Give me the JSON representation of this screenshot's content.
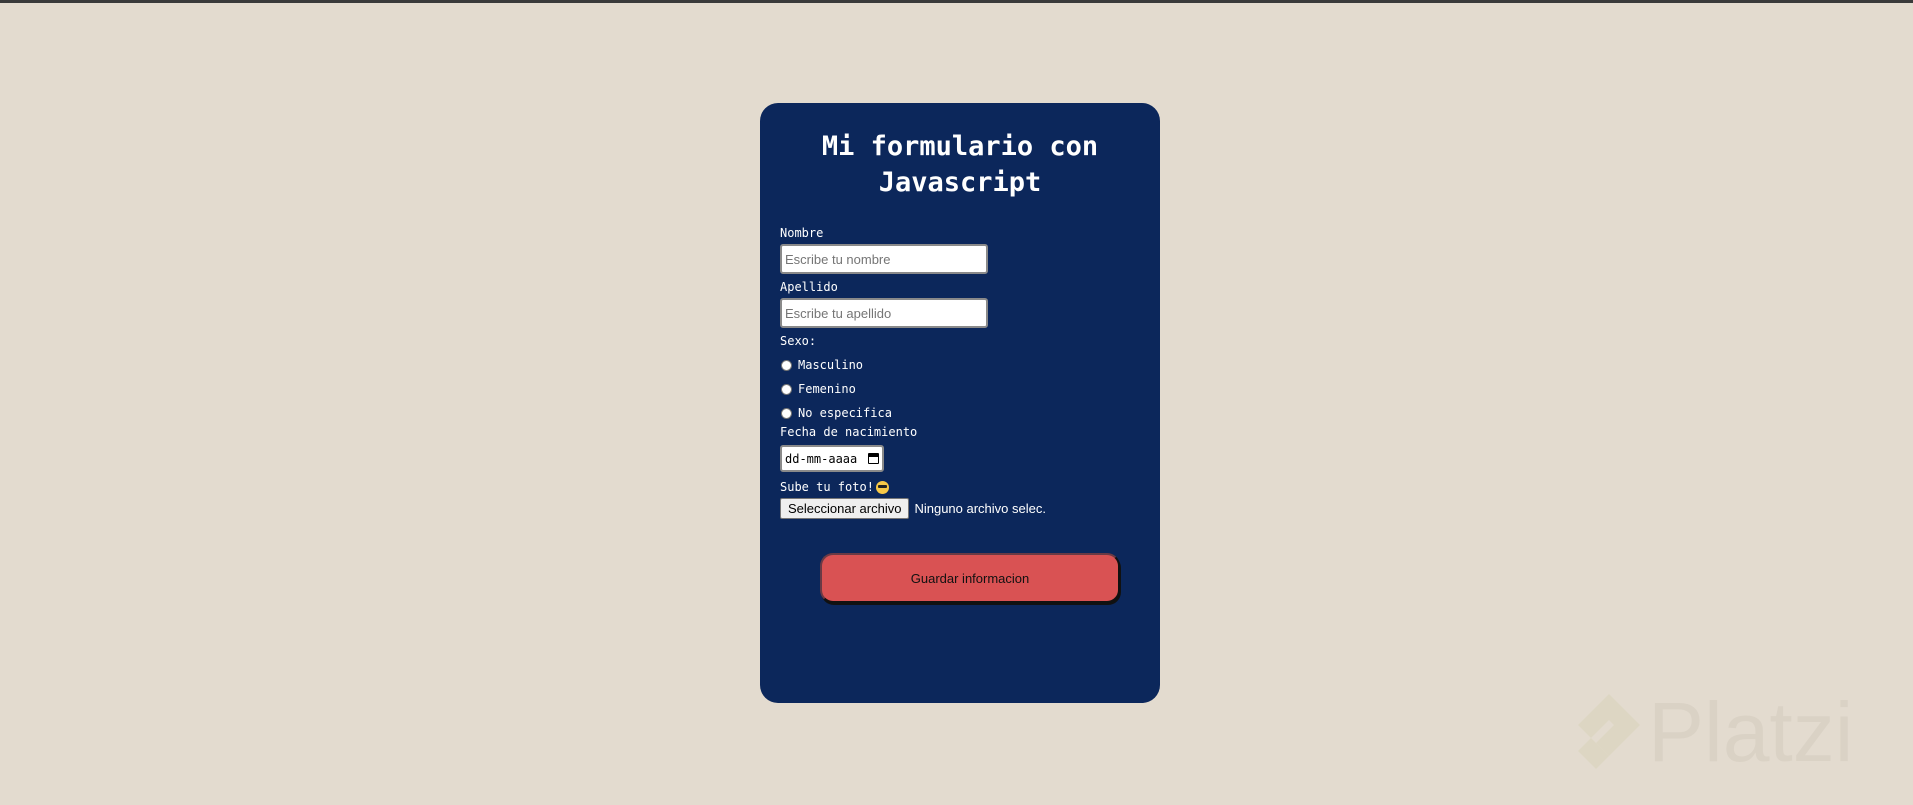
{
  "form": {
    "title": "Mi formulario con Javascript",
    "nombre": {
      "label": "Nombre",
      "placeholder": "Escribe tu nombre",
      "value": ""
    },
    "apellido": {
      "label": "Apellido",
      "placeholder": "Escribe tu apellido",
      "value": ""
    },
    "sexo": {
      "label": "Sexo:",
      "options": [
        "Masculino",
        "Femenino",
        "No especifica"
      ],
      "selected": null
    },
    "fecha": {
      "label": "Fecha de nacimiento",
      "placeholder": "dd-mm-aaaa"
    },
    "foto": {
      "label": "Sube tu foto!",
      "emoji": "smiling-face-with-sunglasses",
      "button_label": "Seleccionar archivo",
      "status": "Ninguno archivo selec."
    },
    "submit_label": "Guardar informacion"
  },
  "watermark": {
    "text": "Platzi"
  },
  "colors": {
    "background": "#e3dbcf",
    "card": "#0c275b",
    "button": "#d95253",
    "text": "#ffffff"
  }
}
